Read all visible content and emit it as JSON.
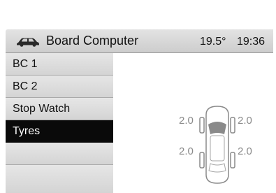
{
  "header": {
    "icon": "car-icon",
    "title": "Board Computer",
    "temperature": "19.5°",
    "time": "19:36"
  },
  "menu": {
    "items": [
      {
        "label": "BC 1",
        "selected": false
      },
      {
        "label": "BC 2",
        "selected": false
      },
      {
        "label": "Stop Watch",
        "selected": false
      },
      {
        "label": "Tyres",
        "selected": true
      },
      {
        "label": "",
        "selected": false
      },
      {
        "label": "",
        "selected": false
      }
    ]
  },
  "tyres": {
    "front_left": "2.0",
    "front_right": "2.0",
    "rear_left": "2.0",
    "rear_right": "2.0",
    "icon": "car-top-view-icon"
  },
  "colors": {
    "selected_bg": "#0a0a0a",
    "selected_text": "#ffffff",
    "tyre_value": "#8a8a8a"
  }
}
